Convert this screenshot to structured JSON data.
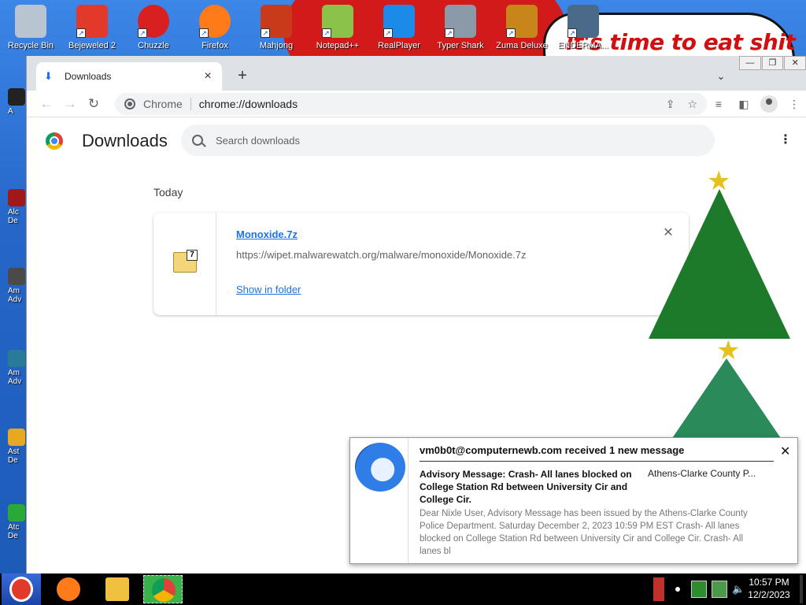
{
  "desktop": {
    "speech_text": "it's time to eat shit",
    "icons": [
      {
        "label": "Recycle Bin",
        "color": "#b8c4d0"
      },
      {
        "label": "Bejeweled 2",
        "color": "#e23a2a"
      },
      {
        "label": "Chuzzle",
        "color": "#d82020"
      },
      {
        "label": "Firefox",
        "color": "#ff7b1a"
      },
      {
        "label": "Mahjong",
        "color": "#c83a1a"
      },
      {
        "label": "Notepad++",
        "color": "#8bc34a"
      },
      {
        "label": "RealPlayer",
        "color": "#1a8be8"
      },
      {
        "label": "Typer Shark",
        "color": "#8a9aa8"
      },
      {
        "label": "Zuma Deluxe",
        "color": "#c8861a"
      },
      {
        "label": "ENDERMA...",
        "color": "#4a6a8a"
      }
    ],
    "left_icons": [
      {
        "label": "A",
        "color": "#222"
      },
      {
        "label": "Alc De",
        "color": "#a01818"
      },
      {
        "label": "Am Adv",
        "color": "#4a4a4a"
      },
      {
        "label": "Am Adv",
        "color": "#2a7a9a"
      },
      {
        "label": "Ast De",
        "color": "#e8a820"
      },
      {
        "label": "Atc De",
        "color": "#2aa838"
      }
    ]
  },
  "browser": {
    "tab_title": "Downloads",
    "window_controls": [
      "—",
      "❐",
      "✕"
    ],
    "omnibox_chip": "Chrome",
    "omnibox_url": "chrome://downloads"
  },
  "downloads": {
    "page_title": "Downloads",
    "search_placeholder": "Search downloads",
    "section": "Today",
    "items": [
      {
        "filename": "Monoxide.7z",
        "url": "https://wipet.malwarewatch.org/malware/monoxide/Monoxide.7z",
        "action": "Show in folder",
        "badge": "7"
      }
    ]
  },
  "notification": {
    "header": "vm0b0t@computernewb.com received 1 new message",
    "subject": "Advisory Message: Crash- All lanes blocked on College Station Rd between University Cir and College Cir.",
    "sender": "Athens-Clarke County P...",
    "body": "Dear Nixle User, Advisory Message has been issued by the Athens-Clarke County Police Department. Saturday December 2, 2023 10:59 PM EST Crash- All lanes blocked on College Station Rd between University Cir and College Cir. Crash- All lanes bl"
  },
  "taskbar": {
    "time": "10:57 PM",
    "date": "12/2/2023",
    "apps": [
      {
        "name": "firefox",
        "color": "#ff7b1a"
      },
      {
        "name": "file-explorer",
        "color": "#f0c040"
      },
      {
        "name": "chrome",
        "color": "#4285f4"
      }
    ]
  }
}
